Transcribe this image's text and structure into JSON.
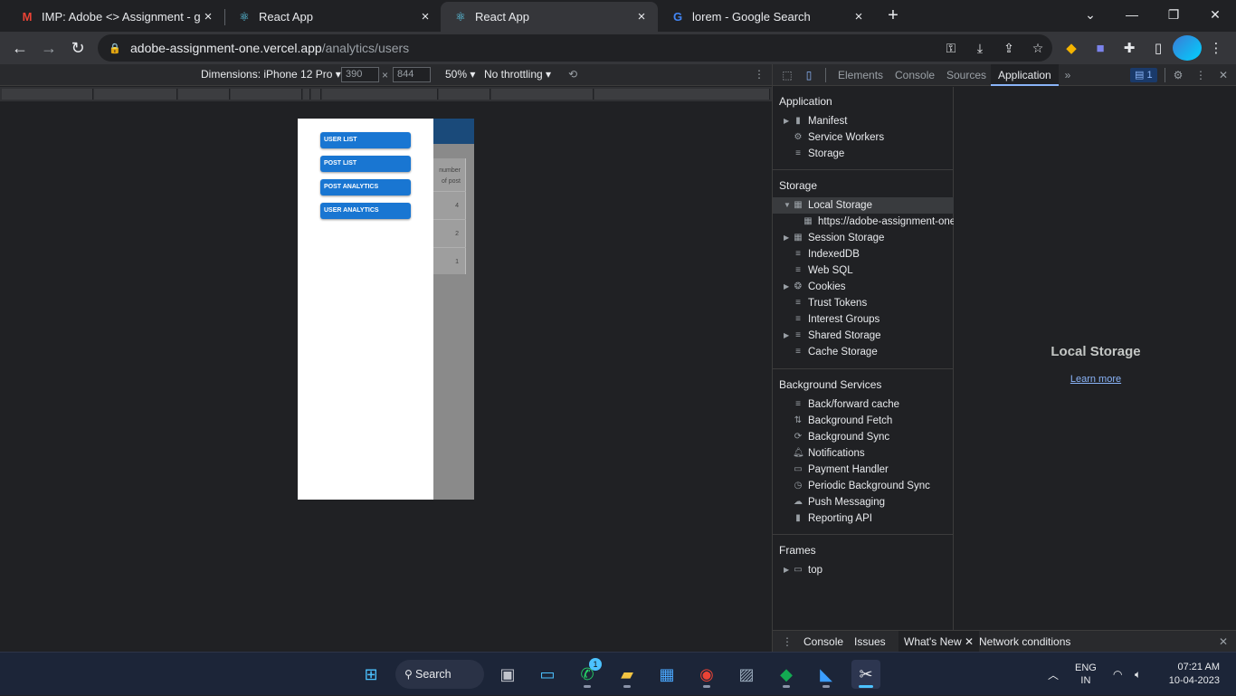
{
  "browser": {
    "tabs": [
      {
        "title": "IMP: Adobe <> Assignment - gh",
        "icon": "gmail-icon",
        "active": false
      },
      {
        "title": "React App",
        "icon": "react-icon",
        "active": false
      },
      {
        "title": "React App",
        "icon": "react-icon",
        "active": true
      },
      {
        "title": "lorem - Google Search",
        "icon": "google-icon",
        "active": false
      }
    ],
    "url_host": "adobe-assignment-one.vercel.app",
    "url_path": "/analytics/users"
  },
  "device_toolbar": {
    "dimensions_label": "Dimensions: iPhone 12 Pro",
    "width": "390",
    "height": "844",
    "times": "×",
    "zoom": "50%",
    "throttling": "No throttling"
  },
  "page": {
    "nav_buttons": [
      "USER LIST",
      "POST LIST",
      "POST ANALYTICS",
      "USER ANALYTICS"
    ],
    "table_header_line1": "number",
    "table_header_line2": "of post",
    "table_values": [
      "4",
      "2",
      "1"
    ]
  },
  "devtools": {
    "tabs": [
      "Elements",
      "Console",
      "Sources",
      "Application"
    ],
    "active_tab": "Application",
    "issues_badge": "1",
    "sections": {
      "application": {
        "title": "Application",
        "items": [
          "Manifest",
          "Service Workers",
          "Storage"
        ]
      },
      "storage": {
        "title": "Storage",
        "items": [
          "Local Storage",
          "https://adobe-assignment-one.vercel.app",
          "Session Storage",
          "IndexedDB",
          "Web SQL",
          "Cookies",
          "Trust Tokens",
          "Interest Groups",
          "Shared Storage",
          "Cache Storage"
        ]
      },
      "background_services": {
        "title": "Background Services",
        "items": [
          "Back/forward cache",
          "Background Fetch",
          "Background Sync",
          "Notifications",
          "Payment Handler",
          "Periodic Background Sync",
          "Push Messaging",
          "Reporting API"
        ]
      },
      "frames": {
        "title": "Frames",
        "items": [
          "top"
        ]
      }
    },
    "main_title": "Local Storage",
    "learn_more": "Learn more",
    "drawer_tabs": [
      "Console",
      "Issues",
      "What's New",
      "Network conditions"
    ]
  },
  "taskbar": {
    "search_label": "Search",
    "whatsapp_badge": "1",
    "lang_line1": "ENG",
    "lang_line2": "IN",
    "time": "07:21 AM",
    "date": "10-04-2023"
  }
}
